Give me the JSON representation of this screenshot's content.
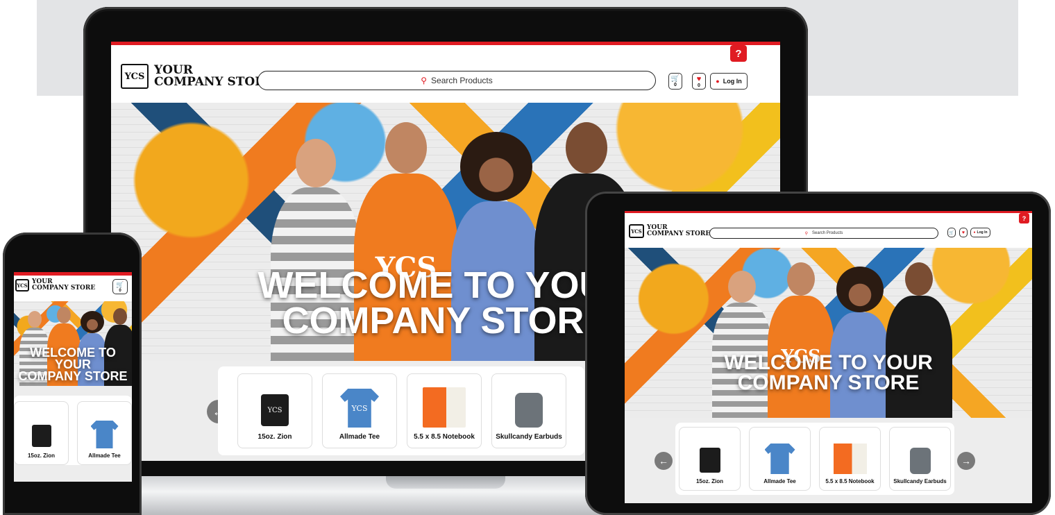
{
  "colors": {
    "brand_red": "#e01b22",
    "tee_orange": "#f07b1f",
    "tee_blue": "#4a86c8",
    "backdrop_gray": "#e3e4e6",
    "carousel_gray": "#ededed"
  },
  "icons": {
    "search": "search-icon",
    "cart": "cart-icon",
    "heart": "heart-icon",
    "user": "user-icon",
    "help": "help-icon",
    "arrow_left": "arrow-left-icon",
    "arrow_right": "arrow-right-icon",
    "logo": "company-monogram-logo"
  },
  "logo": {
    "line1": "YOUR",
    "line2": "COMPANY STORE",
    "monogram": "YCS"
  },
  "header": {
    "search_placeholder": "Search Products",
    "cart_count": "0",
    "wishlist_count": "0",
    "login_label": "Log In",
    "help_glyph": "?"
  },
  "hero": {
    "line1": "WELCOME TO YOUR",
    "line2": "COMPANY STORE"
  },
  "products": [
    {
      "name": "15oz. Zion",
      "kind": "mug"
    },
    {
      "name": "Allmade Tee",
      "kind": "tee"
    },
    {
      "name": "5.5 x 8.5 Notebook",
      "kind": "notebook"
    },
    {
      "name": "Skullcandy Earbuds",
      "kind": "earbuds"
    }
  ],
  "carousel": {
    "prev": "←",
    "next": "→"
  }
}
